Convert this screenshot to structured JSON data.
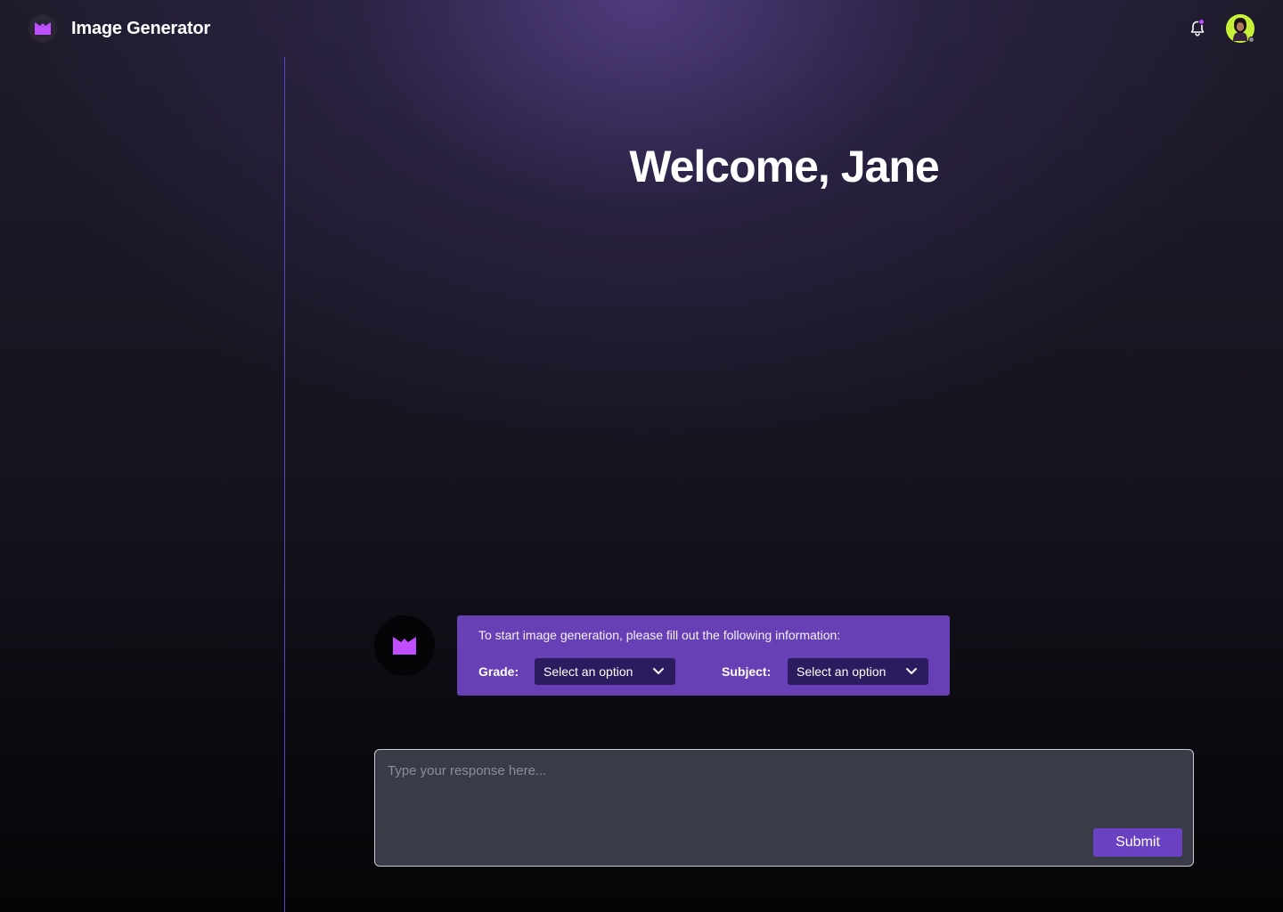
{
  "app": {
    "title": "Image Generator",
    "logo_icon": "m-logo-icon",
    "brand_color": "#c04dff"
  },
  "header": {
    "notification_icon": "bell-icon",
    "avatar_icon": "user-avatar"
  },
  "main": {
    "welcome": "Welcome, Jane"
  },
  "bot_message": {
    "text": "To start image generation, please fill out the following information:",
    "grade_label": "Grade:",
    "grade_value": "Select an option",
    "subject_label": "Subject:",
    "subject_value": "Select an option"
  },
  "response": {
    "placeholder": "Type your response here...",
    "submit_label": "Submit"
  },
  "colors": {
    "accent": "#6a41c2",
    "card": "#6640b4",
    "select_bg": "#2c1b5e",
    "divider": "#5a46c8"
  }
}
